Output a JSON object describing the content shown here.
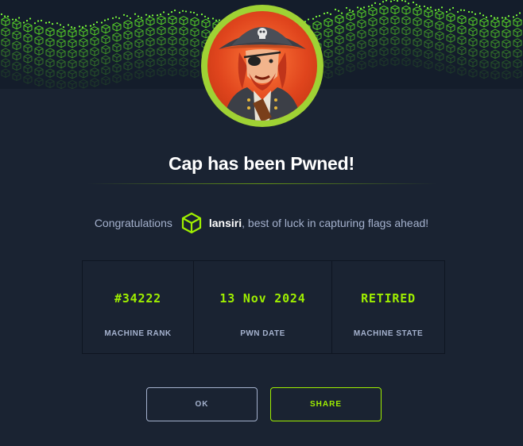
{
  "header": {
    "banner_pattern": "green-cube-wave",
    "avatar_name": "pirate-avatar"
  },
  "dialog": {
    "title": "Cap has been Pwned!",
    "congrats_prefix": "Congratulations",
    "user_icon": "htb-cube-icon",
    "username": "lansiri",
    "congrats_suffix": ", best of luck in capturing flags ahead!"
  },
  "stats": [
    {
      "value": "#34222",
      "label": "MACHINE RANK"
    },
    {
      "value": "13 Nov 2024",
      "label": "PWN DATE"
    },
    {
      "value": "RETIRED",
      "label": "MACHINE STATE"
    }
  ],
  "buttons": {
    "ok_label": "OK",
    "share_label": "SHARE"
  },
  "colors": {
    "background": "#1a2332",
    "accent_green": "#9fef00",
    "muted_text": "#a4b1cd",
    "avatar_ring": "#9fd234"
  }
}
